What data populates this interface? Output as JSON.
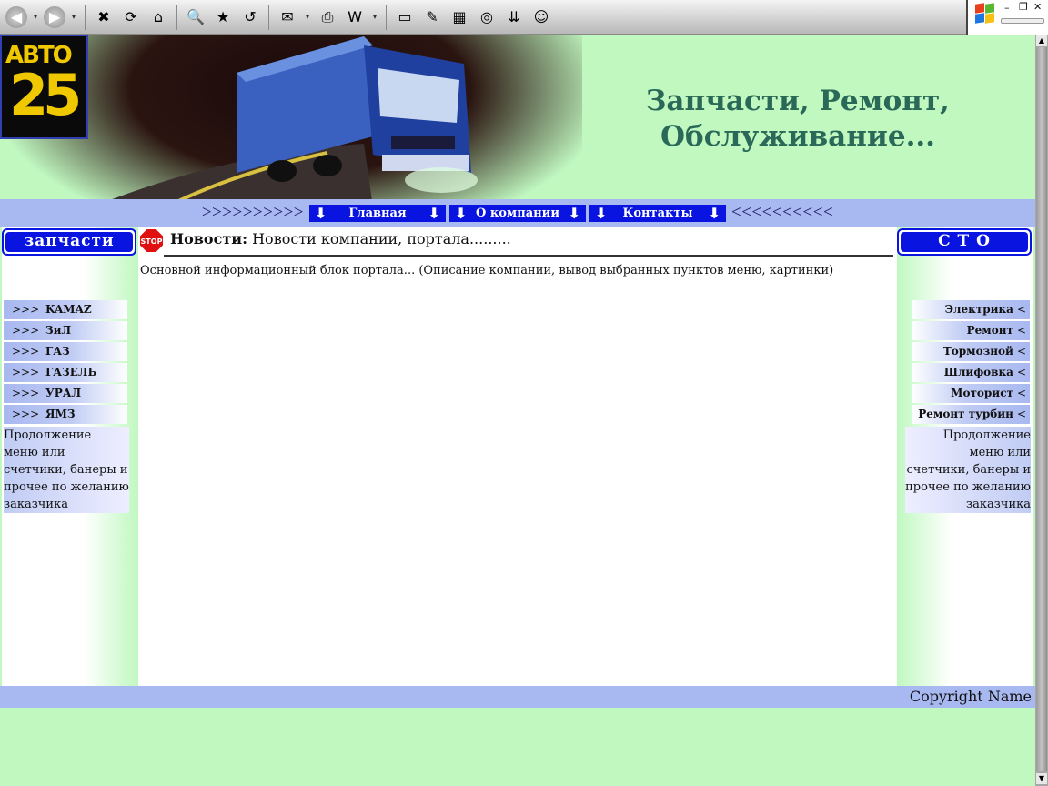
{
  "toolbar": {
    "buttons": [
      {
        "name": "back-icon",
        "glyph": "◀"
      },
      {
        "name": "forward-icon",
        "glyph": "▶"
      },
      {
        "name": "stop-icon",
        "glyph": "✖"
      },
      {
        "name": "refresh-icon",
        "glyph": "⟳"
      },
      {
        "name": "home-icon",
        "glyph": "⌂"
      },
      {
        "name": "search-icon",
        "glyph": "🔍"
      },
      {
        "name": "favorites-icon",
        "glyph": "★"
      },
      {
        "name": "history-icon",
        "glyph": "↺"
      },
      {
        "name": "mail-icon",
        "glyph": "✉"
      },
      {
        "name": "print-icon",
        "glyph": "⎙"
      },
      {
        "name": "edit-icon",
        "glyph": "W"
      },
      {
        "name": "notes-icon",
        "glyph": "▭"
      },
      {
        "name": "messenger-icon",
        "glyph": "✎"
      },
      {
        "name": "pro-icon",
        "glyph": "▦"
      },
      {
        "name": "research-icon",
        "glyph": "◎"
      },
      {
        "name": "download-icon",
        "glyph": "⇊"
      },
      {
        "name": "people-icon",
        "glyph": "☺"
      }
    ]
  },
  "header": {
    "logo_top": "АВТО",
    "logo_number": "25",
    "tagline_line1": "Запчасти, Ремонт,",
    "tagline_line2": "Обслуживание..."
  },
  "nav": {
    "left_arrows": ">>>>>>>>>>",
    "right_arrows": "<<<<<<<<<<",
    "items": [
      {
        "label": "Главная",
        "width": 150
      },
      {
        "label": "О компании",
        "width": 150
      },
      {
        "label": "Контакты",
        "width": 150
      }
    ]
  },
  "left_panel": {
    "title": "запчасти",
    "marker": ">>>",
    "items": [
      "KAMAZ",
      "ЗиЛ",
      "ГАЗ",
      "ГАЗЕЛЬ",
      "УРАЛ",
      "ЯМЗ"
    ],
    "filler": "Продолжение меню или счетчики, банеры и прочее по желанию заказчика"
  },
  "right_panel": {
    "title": "С Т О",
    "marker": "<",
    "items": [
      "Электрика",
      "Ремонт",
      "Тормозной",
      "Шлифовка",
      "Моторист",
      "Ремонт турбин"
    ],
    "filler": "Продолжение меню или счетчики, банеры и прочее по желанию заказчика"
  },
  "news": {
    "stop_label": "STOP",
    "label": "Новости:",
    "text": " Новости компании, портала........."
  },
  "content": {
    "text": "Основной информационный блок портала... (Описание компании, вывод выбранных пунктов меню, картинки)"
  },
  "footer": {
    "copyright": "Copyright Name"
  },
  "colors": {
    "page_bg": "#c0f8c0",
    "bar_bg": "#a8b8f0",
    "nav_button": "#0a14e0",
    "tagline": "#2a6858",
    "logo_yellow": "#f0c800"
  }
}
